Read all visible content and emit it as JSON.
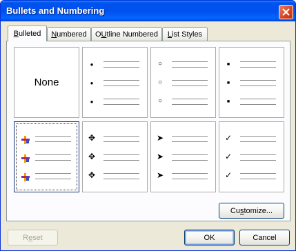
{
  "window": {
    "title": "Bullets and Numbering",
    "close_icon": "close-icon"
  },
  "tabs": [
    {
      "label": "Bulleted",
      "accel": "B",
      "rest": "ulleted",
      "active": true
    },
    {
      "label": "Numbered",
      "accel": "N",
      "rest": "umbered",
      "active": false
    },
    {
      "label": "Outline Numbered",
      "accel": "U",
      "pre": "O",
      "rest": "tline Numbered",
      "active": false
    },
    {
      "label": "List Styles",
      "accel": "L",
      "rest": "ist Styles",
      "active": false
    }
  ],
  "bullet_options": [
    {
      "name": "none",
      "label": "None",
      "glyph": ""
    },
    {
      "name": "filled-circle",
      "glyph": "●"
    },
    {
      "name": "hollow-circle",
      "glyph": "○"
    },
    {
      "name": "filled-square",
      "glyph": "■"
    },
    {
      "name": "picture-bullet",
      "glyph": "picture",
      "selected": true
    },
    {
      "name": "four-diamond",
      "glyph": "✥"
    },
    {
      "name": "arrowhead",
      "glyph": "➤"
    },
    {
      "name": "checkmark",
      "glyph": "✓"
    }
  ],
  "buttons": {
    "customize": {
      "label": "Customize...",
      "accel_pre": "Cu",
      "accel": "s",
      "rest": "tomize..."
    },
    "reset": {
      "label": "Reset",
      "accel_pre": "R",
      "accel": "e",
      "rest": "set"
    },
    "ok": {
      "label": "OK"
    },
    "cancel": {
      "label": "Cancel"
    }
  },
  "colors": {
    "title_bar": "#0054e3",
    "dialog_bg": "#ece9d8",
    "active_tab_accent": "#ffc83c"
  }
}
